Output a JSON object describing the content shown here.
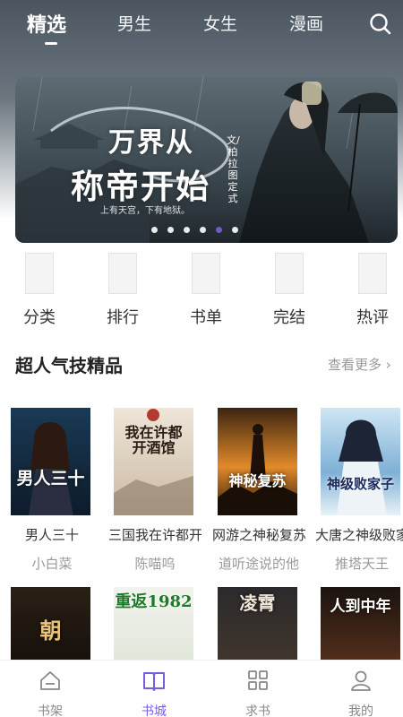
{
  "top_nav": {
    "tabs": [
      "精选",
      "男生",
      "女生",
      "漫画"
    ],
    "active_index": 0
  },
  "banner": {
    "title_line1": "万界从",
    "title_line2": "称帝开始",
    "author": "文/柏拉图定式",
    "slogan": "上有天宫，下有地狱。",
    "page_count": 6,
    "active_page": 4
  },
  "categories": [
    {
      "label": "分类"
    },
    {
      "label": "排行"
    },
    {
      "label": "书单"
    },
    {
      "label": "完结"
    },
    {
      "label": "热评"
    }
  ],
  "section": {
    "title": "超人气技精品",
    "more_label": "查看更多"
  },
  "books_row1": [
    {
      "title": "男人三十",
      "author": "小白菜",
      "cover_text": "男人三十"
    },
    {
      "title": "三国我在许都开酒馆",
      "author": "陈喵呜",
      "cover_text": "我在许都开酒馆"
    },
    {
      "title": "网游之神秘复苏",
      "author": "道听途说的他",
      "cover_text": "神秘复苏"
    },
    {
      "title": "大唐之神级败家子",
      "author": "推塔天王",
      "cover_text": "神级败家子"
    }
  ],
  "books_row2": [
    {
      "cover_text": "朝"
    },
    {
      "cover_text": "重返1982"
    },
    {
      "cover_text": "凌霄"
    },
    {
      "cover_text": "人到中年"
    }
  ],
  "bottom_nav": {
    "items": [
      "书架",
      "书城",
      "求书",
      "我的"
    ],
    "active_index": 1
  },
  "colors": {
    "accent": "#7b5ce0",
    "text_primary": "#333333",
    "text_secondary": "#999999"
  }
}
